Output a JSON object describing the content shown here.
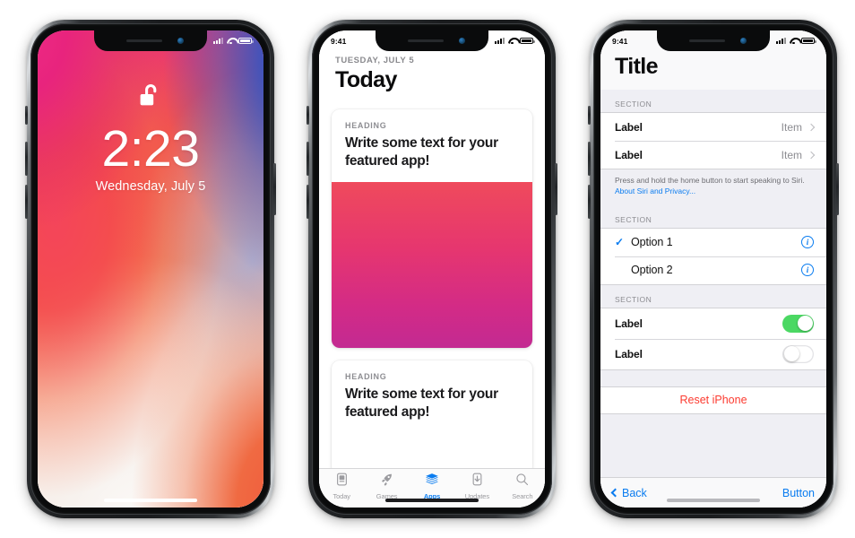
{
  "phones": [
    {
      "id": "lockscreen",
      "name": "iPhone X Lock Screen",
      "status_bar": {
        "time": "",
        "signal_icon": "cellular-signal-icon",
        "wifi_icon": "wifi-icon",
        "battery_icon": "battery-icon"
      },
      "lock": {
        "icon": "unlocked-padlock-icon",
        "time": "2:23",
        "date": "Wednesday, July 5"
      },
      "wallpaper_colors": {
        "magenta": "#e6238a",
        "blue": "#2f55c4",
        "coral": "#f15a3c",
        "cream": "#f7f2ee"
      }
    },
    {
      "id": "today",
      "name": "App Store Today",
      "status_bar": {
        "time": "9:41",
        "signal_icon": "cellular-signal-icon",
        "wifi_icon": "wifi-icon",
        "battery_icon": "battery-icon"
      },
      "header": {
        "kicker": "TUESDAY, JULY 5",
        "title": "Today"
      },
      "cards": [
        {
          "heading": "HEADING",
          "title": "Write some text for your featured app!",
          "has_art": true
        },
        {
          "heading": "HEADING",
          "title": "Write some text for your featured app!",
          "has_art": false
        }
      ],
      "art_gradient": {
        "from": "#ef4a5c",
        "to": "#c32a92"
      },
      "tabs": [
        {
          "label": "Today",
          "icon": "today-card-icon",
          "active": false
        },
        {
          "label": "Games",
          "icon": "rocket-icon",
          "active": false
        },
        {
          "label": "Apps",
          "icon": "app-stack-icon",
          "active": true
        },
        {
          "label": "Updates",
          "icon": "download-icon",
          "active": false
        },
        {
          "label": "Search",
          "icon": "search-icon",
          "active": false
        }
      ],
      "accent_color": "#0a7cf0"
    },
    {
      "id": "settings",
      "name": "Settings Table View",
      "status_bar": {
        "time": "9:41",
        "signal_icon": "cellular-signal-icon",
        "wifi_icon": "wifi-icon",
        "battery_icon": "battery-icon"
      },
      "title": "Title",
      "sections": [
        {
          "header": "SECTION",
          "type": "disclosure",
          "rows": [
            {
              "label": "Label",
              "value": "Item",
              "accessory": "chevron-right-icon"
            },
            {
              "label": "Label",
              "value": "Item",
              "accessory": "chevron-right-icon"
            }
          ],
          "footer_text": "Press and hold the home button to start speaking to Siri. ",
          "footer_link": "About Siri and Privacy..."
        },
        {
          "header": "SECTION",
          "type": "choice",
          "rows": [
            {
              "label": "Option 1",
              "checked": true,
              "accessory": "info-icon"
            },
            {
              "label": "Option 2",
              "checked": false,
              "accessory": "info-icon"
            }
          ]
        },
        {
          "header": "SECTION",
          "type": "switch",
          "rows": [
            {
              "label": "Label",
              "on": true
            },
            {
              "label": "Label",
              "on": false
            }
          ]
        }
      ],
      "destructive_action": "Reset iPhone",
      "toolbar": {
        "back_label": "Back",
        "back_icon": "chevron-left-icon",
        "button_label": "Button"
      },
      "colors": {
        "accent": "#0a7cf0",
        "destructive": "#fc3b30",
        "switch_on": "#4bd863"
      }
    }
  ]
}
